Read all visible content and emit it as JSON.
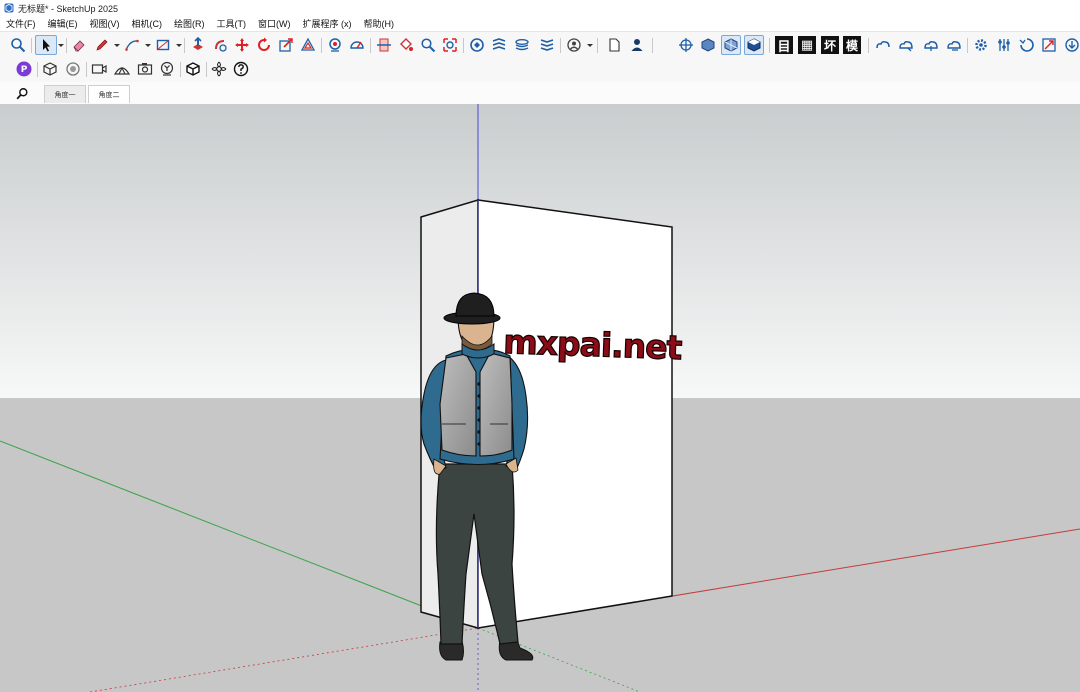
{
  "window": {
    "title": "无标题* - SketchUp 2025",
    "icon": "sketchup-logo-icon"
  },
  "menu": [
    "文件(F)",
    "编辑(E)",
    "视图(V)",
    "相机(C)",
    "绘图(R)",
    "工具(T)",
    "窗口(W)",
    "扩展程序 (x)",
    "帮助(H)"
  ],
  "toolbar": {
    "row1_icons": [
      "zoom-icon",
      "select-icon",
      "eraser-icon",
      "pencil-line-icon",
      "arc-icon",
      "rectangle-icon",
      "push-pull-icon",
      "follow-me-icon",
      "move-icon",
      "rotate-icon",
      "scale-icon",
      "offset-icon",
      "tape-measure-icon",
      "protractor-icon",
      "section-plane-icon",
      "paint-bucket-icon",
      "zoom-window-icon",
      "zoom-extents-icon",
      "warehouse-icon",
      "extension-warehouse-icon",
      "layers-icon",
      "scenes-icon",
      "account-icon",
      "new-file-icon",
      "user-icon",
      "orbit-icon",
      "iso-view-icon",
      "xray-icon",
      "shaded-icon",
      "style-icon-1",
      "style-icon-2",
      "style-icon-3",
      "style-icon-4",
      "cloud-icon-1",
      "cloud-icon-2",
      "cloud-icon-3",
      "cloud-icon-4",
      "settings-icon",
      "sliders-icon",
      "window-icon",
      "download-icon"
    ],
    "row2_icons": [
      "purple-extension-icon",
      "box-icon",
      "circle-icon",
      "camera-rect-icon",
      "tent-icon",
      "photo-icon",
      "yard-icon",
      "cube-icon",
      "flower-icon",
      "help-icon"
    ],
    "style_glyphs": [
      "目",
      "▦",
      "坏",
      "模"
    ]
  },
  "tabs": [
    {
      "label": "角度一",
      "active": false
    },
    {
      "label": "角度二",
      "active": true
    }
  ],
  "canvas": {
    "watermark": "mxpai.net",
    "colors": {
      "sky_top": "#c8cccd",
      "sky_bottom": "#f7f8f8",
      "ground": "#c8c8c8",
      "axis_red": "#c43b3b",
      "axis_green": "#3aa34a",
      "axis_blue": "#4a4ad0"
    }
  }
}
